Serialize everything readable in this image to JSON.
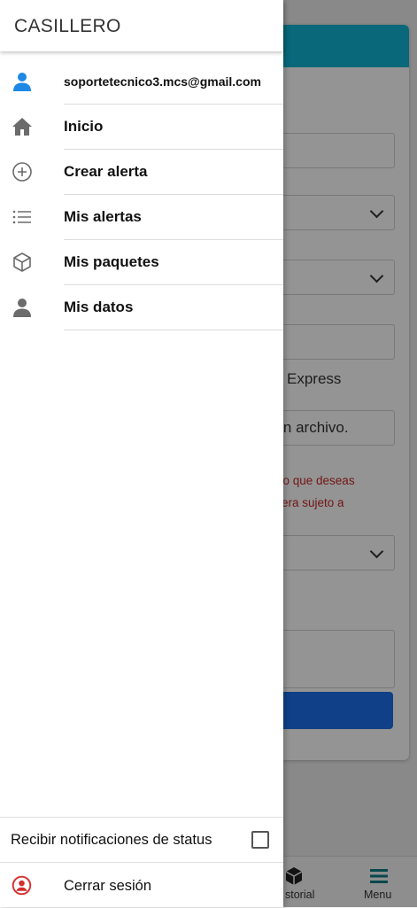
{
  "background": {
    "express_text": "Express",
    "file_text": "gún archivo.",
    "notice_line1": "vicio que deseas",
    "notice_line2": "o sera sujeto a",
    "nav": {
      "historial_label": "storial",
      "menu_label": "Menu"
    },
    "colors": {
      "header": "#11b3d1",
      "primary_button": "#1d6fe8",
      "notice": "#c62828",
      "menu_icon": "#0e7c86"
    }
  },
  "drawer": {
    "title": "CASILLERO",
    "user_email": "soportetecnico3.mcs@gmail.com",
    "items": [
      {
        "label": "Inicio",
        "icon": "home-icon"
      },
      {
        "label": "Crear alerta",
        "icon": "plus-circle-icon"
      },
      {
        "label": "Mis alertas",
        "icon": "list-icon"
      },
      {
        "label": "Mis paquetes",
        "icon": "package-icon"
      },
      {
        "label": "Mis datos",
        "icon": "person-icon"
      }
    ],
    "notifications_label": "Recibir notificaciones de status",
    "notifications_checked": false,
    "logout_label": "Cerrar sesión",
    "colors": {
      "user_icon": "#1e88e5",
      "logout_icon": "#d32f2f",
      "icons": "#6b6b6b"
    }
  }
}
